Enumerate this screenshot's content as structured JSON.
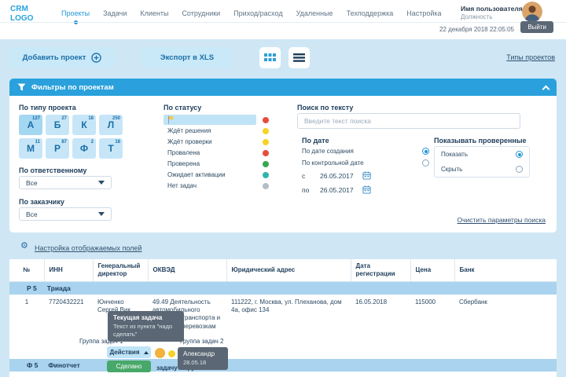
{
  "header": {
    "logo": "CRM LOGO",
    "nav": [
      {
        "label": "Проекты"
      },
      {
        "label": "Задачи"
      },
      {
        "label": "Клиенты"
      },
      {
        "label": "Сотрудники"
      },
      {
        "label": "Приход/расход"
      },
      {
        "label": "Удаленные"
      },
      {
        "label": "Техподдержка"
      },
      {
        "label": "Настройка"
      }
    ],
    "user": {
      "name": "Имя пользователя",
      "role": "Должность",
      "datetime": "22 декабря 2018 22:05:05",
      "logout_label": "Выйти"
    }
  },
  "toolbar": {
    "add_project": "Добавить проект",
    "export_xls": "Экспорт в XLS",
    "project_types": "Типы проектов"
  },
  "filters": {
    "title": "Фильтры по проектам",
    "by_type": {
      "label": "По типу проекта",
      "tiles": [
        {
          "letter": "А",
          "count": "127"
        },
        {
          "letter": "Б",
          "count": "27"
        },
        {
          "letter": "К",
          "count": "18"
        },
        {
          "letter": "Л",
          "count": "250"
        },
        {
          "letter": "М",
          "count": "11"
        },
        {
          "letter": "Р",
          "count": "87"
        },
        {
          "letter": "Ф",
          "count": "2"
        },
        {
          "letter": "Т",
          "count": "18"
        }
      ]
    },
    "by_responsible": {
      "label": "По ответственному",
      "value": "Все"
    },
    "by_customer": {
      "label": "По заказчику",
      "value": "Все"
    },
    "by_status": {
      "label": "По статусу",
      "items": [
        {
          "label": "",
          "color": "#e84c3d",
          "flagged": true,
          "selected": true
        },
        {
          "label": "Ждёт решения",
          "color": "#f5d327"
        },
        {
          "label": "Ждёт проверки",
          "color": "#f5d327"
        },
        {
          "label": "Провалена",
          "color": "#e84c3d"
        },
        {
          "label": "Проверена",
          "color": "#37a84f"
        },
        {
          "label": "Ожидает активации",
          "color": "#2eb5ad"
        },
        {
          "label": "Нет задач",
          "color": "#b4bec6"
        }
      ]
    },
    "search": {
      "label": "Поиск по тексту",
      "placeholder": "Введите текст поиска"
    },
    "by_date": {
      "label": "По дате",
      "options": [
        {
          "label": "По дате создания",
          "selected": true
        },
        {
          "label": "По контрольной дате",
          "selected": false
        }
      ],
      "from_label": "с",
      "from_value": "26.05.2017",
      "to_label": "по",
      "to_value": "26.05.2017"
    },
    "show_checked": {
      "label": "Показывать проверенные",
      "options": [
        {
          "label": "Показать",
          "selected": true
        },
        {
          "label": "Скрыть",
          "selected": false
        }
      ]
    },
    "clear_link": "Очистить параметры поиска"
  },
  "table": {
    "settings_link": "Настройка отображаемых полей",
    "columns": [
      "№",
      "ИНН",
      "Генеральный директор",
      "ОКВЭД",
      "Юридический адрес",
      "Дата регистрации",
      "Цена",
      "Банк"
    ],
    "group1": {
      "code": "Р 5",
      "name": "Триада"
    },
    "row1": {
      "num": "1",
      "inn": "7720432221",
      "director": "Юнченко Сергей Вик...",
      "okved": "49.49 Деятельность автомобильного грузового транспорта и услуги по перевозкам",
      "address": "111222, г. Москва, ул. Плеханова, дом 4а, офис 134",
      "reg_date": "16.05.2018",
      "price": "115000",
      "bank": "Сбербанк"
    },
    "group2": {
      "code": "Ф 5",
      "name": "Финотчет"
    },
    "tasks": {
      "group1_label": "Группа задач 1",
      "group2_label": "Группа задач 2",
      "actions_label": "Действия",
      "done_label": "Сделано",
      "partial_label": "задачу в группе"
    }
  },
  "tooltips": {
    "current_task": {
      "title": "Текущая задача",
      "body": "Текст из пункта \"надо сделать\""
    },
    "assignee": {
      "name": "Александр",
      "date": "28.05.18"
    }
  }
}
